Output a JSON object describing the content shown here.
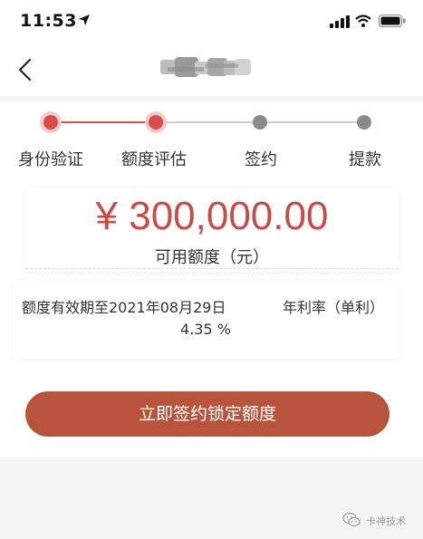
{
  "status_bar": {
    "time": "11:53"
  },
  "steps": [
    {
      "label": "身份验证",
      "state": "done"
    },
    {
      "label": "额度评估",
      "state": "done"
    },
    {
      "label": "签约",
      "state": "todo"
    },
    {
      "label": "提款",
      "state": "todo"
    }
  ],
  "amount": {
    "value": "¥ 300,000.00",
    "label": "可用额度（元）"
  },
  "info": {
    "validity": "额度有效期至2021年08月29日",
    "rate_label": "年利率（单利）",
    "rate_value": "4.35 %"
  },
  "action": {
    "sign_label": "立即签约锁定额度"
  },
  "watermark": {
    "text": "卡神技术"
  },
  "colors": {
    "accent": "#c94b47",
    "button": "#b8543b",
    "step_done": "#d94c4c",
    "step_todo": "#8a8a8a"
  },
  "icons": {
    "back": "chevron-left-icon",
    "location": "location-arrow-icon",
    "signal": "cellular-signal-icon",
    "wifi": "wifi-icon",
    "battery": "battery-icon",
    "watermark": "wechat-icon"
  }
}
